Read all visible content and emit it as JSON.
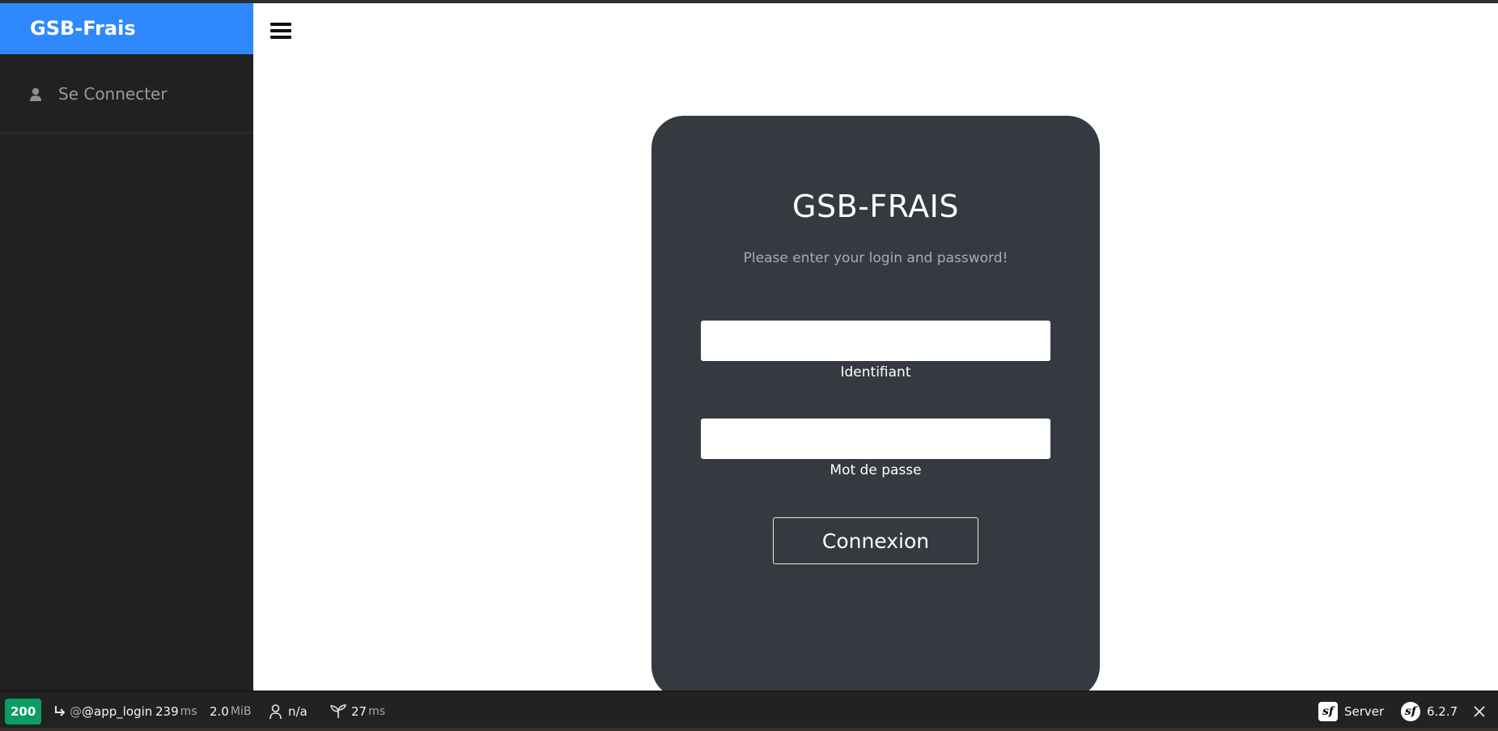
{
  "sidebar": {
    "brand": "GSB-Frais",
    "items": [
      {
        "label": "Se Connecter",
        "icon": "user-icon"
      }
    ]
  },
  "header": {
    "menu_icon": "hamburger-menu-icon"
  },
  "login": {
    "title": "GSB-FRAIS",
    "subtitle": "Please enter your login and password!",
    "username_label": "Identifiant",
    "username_value": "",
    "password_label": "Mot de passe",
    "password_value": "",
    "submit_label": "Connexion"
  },
  "debug_toolbar": {
    "status_code": "200",
    "route": "@app_login",
    "time_value": "239",
    "time_unit": "ms",
    "memory_value": "2.0",
    "memory_unit": "MiB",
    "user": "n/a",
    "twig_time_value": "27",
    "twig_time_unit": "ms",
    "server_label": "Server",
    "symfony_version": "6.2.7"
  },
  "colors": {
    "brand_blue": "#2f89fc",
    "sidebar_bg": "#212121",
    "card_bg": "#343a40",
    "status_green": "#0b9d63"
  }
}
